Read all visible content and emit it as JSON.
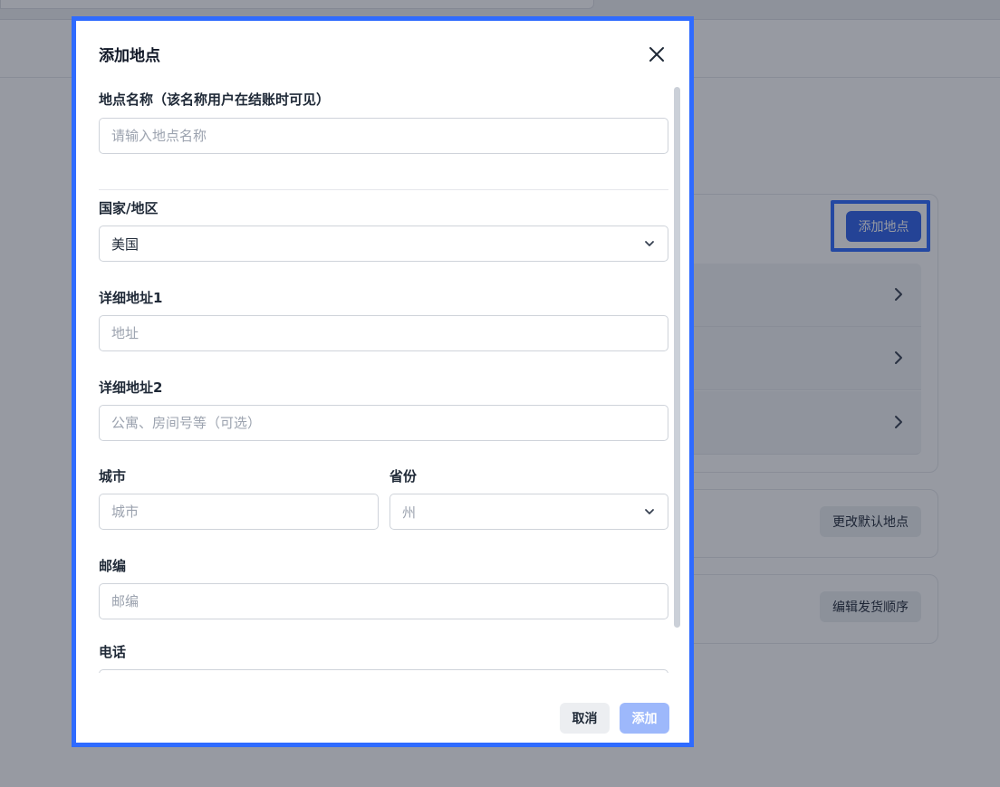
{
  "background": {
    "add_location_button": "添加地点",
    "change_default_button": "更改默认地点",
    "edit_order_button": "编辑发货顺序"
  },
  "modal": {
    "title": "添加地点",
    "fields": {
      "location_name": {
        "label": "地点名称（该名称用户在结账时可见）",
        "placeholder": "请输入地点名称",
        "value": ""
      },
      "country": {
        "label": "国家/地区",
        "value": "美国"
      },
      "address1": {
        "label": "详细地址1",
        "placeholder": "地址",
        "value": ""
      },
      "address2": {
        "label": "详细地址2",
        "placeholder": "公寓、房间号等（可选）",
        "value": ""
      },
      "city": {
        "label": "城市",
        "placeholder": "城市",
        "value": ""
      },
      "state": {
        "label": "省份",
        "placeholder": "州"
      },
      "zip": {
        "label": "邮编",
        "placeholder": "邮编",
        "value": ""
      },
      "phone": {
        "label": "电话",
        "placeholder": "",
        "value": ""
      }
    },
    "cancel_label": "取消",
    "add_label": "添加"
  },
  "colors": {
    "accent": "#2f6bff",
    "primary_button": "#2f62e9",
    "disabled_button": "#9db8fb"
  },
  "icons": {
    "close": "close-icon",
    "chevron_down": "chevron-down-icon",
    "chevron_right": "chevron-right-icon"
  }
}
